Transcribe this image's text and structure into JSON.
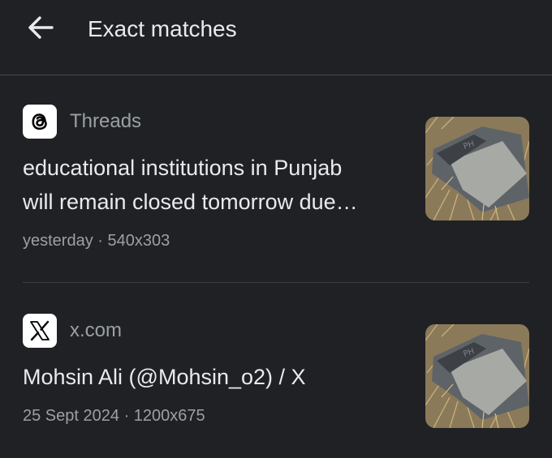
{
  "header": {
    "title": "Exact matches",
    "back_icon": "arrow-left-icon"
  },
  "results": [
    {
      "source": "Threads",
      "favicon": "threads-logo-icon",
      "headline_line1": "educational institutions in Punjab",
      "headline_line2": "will remain closed tomorrow due…",
      "time": "yesterday",
      "dimensions": "540x303",
      "thumbnail": "wreckage-on-dry-grass-image"
    },
    {
      "source": "x.com",
      "favicon": "x-logo-icon",
      "headline_line1": "Mohsin Ali (@Mohsin_o2) / X",
      "time": "25 Sept 2024",
      "dimensions": "1200x675",
      "thumbnail": "wreckage-on-dry-grass-image"
    }
  ],
  "separator": "·",
  "colors": {
    "background": "#202124",
    "primary_text": "#e8eaed",
    "secondary_text": "#9aa0a6",
    "divider": "#3c3d40"
  }
}
